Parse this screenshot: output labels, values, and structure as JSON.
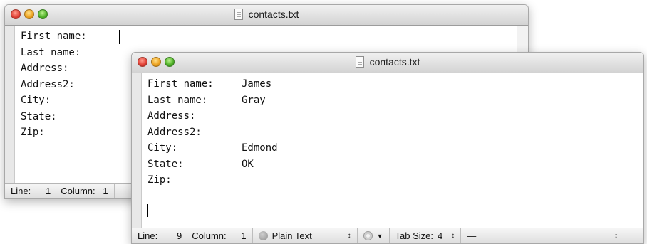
{
  "back_window": {
    "title": "contacts.txt",
    "lines": [
      {
        "label": "First name:",
        "value": ""
      },
      {
        "label": "Last name:",
        "value": ""
      },
      {
        "label": "Address:",
        "value": ""
      },
      {
        "label": "Address2:",
        "value": ""
      },
      {
        "label": "City:",
        "value": ""
      },
      {
        "label": "State:",
        "value": ""
      },
      {
        "label": "Zip:",
        "value": ""
      }
    ],
    "status": {
      "line_label": "Line:",
      "line_value": "1",
      "column_label": "Column:",
      "column_value": "1"
    }
  },
  "front_window": {
    "title": "contacts.txt",
    "lines": [
      {
        "label": "First name:",
        "value": "James"
      },
      {
        "label": "Last name:",
        "value": "Gray"
      },
      {
        "label": "Address:",
        "value": ""
      },
      {
        "label": "Address2:",
        "value": ""
      },
      {
        "label": "City:",
        "value": "Edmond"
      },
      {
        "label": "State:",
        "value": "OK"
      },
      {
        "label": "Zip:",
        "value": ""
      }
    ],
    "status": {
      "line_label": "Line:",
      "line_value": "9",
      "column_label": "Column:",
      "column_value": "1",
      "mode": "Plain Text",
      "tab_size_label": "Tab Size:",
      "tab_size_value": "4",
      "function_value": "—"
    }
  },
  "icons": {
    "close": "close-light-icon",
    "minimize": "minimize-light-icon",
    "zoom": "zoom-light-icon",
    "document": "text-document-icon",
    "gear": "gear-icon",
    "popup": "popup-arrows-icon"
  }
}
